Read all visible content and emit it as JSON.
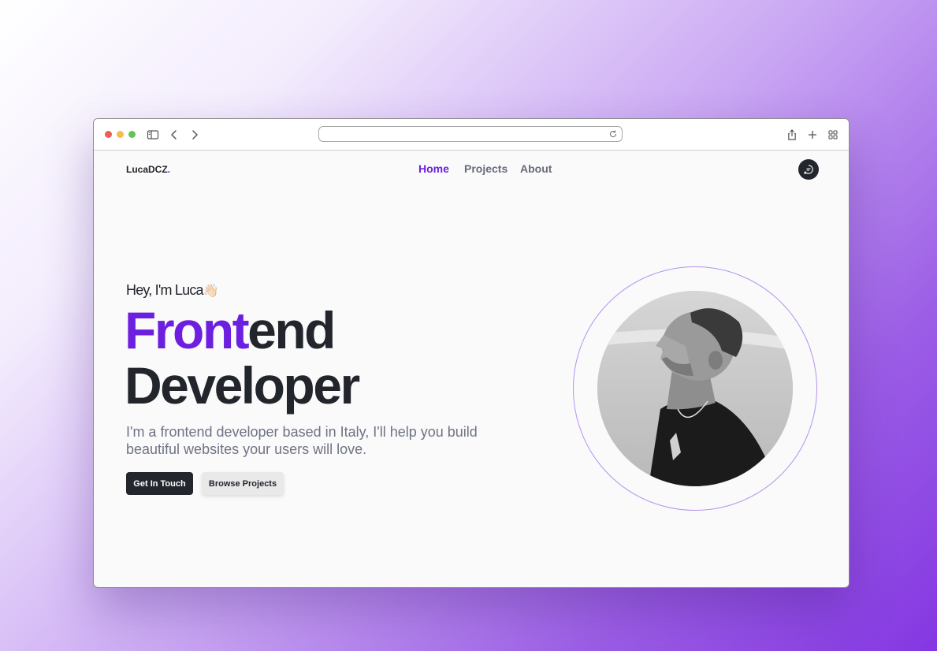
{
  "browser": {
    "url": "",
    "traffic_light_colors": [
      "#ee5f57",
      "#f5bd4f",
      "#61c554"
    ]
  },
  "site": {
    "logo": "LucaDCZ",
    "logo_dot": ".",
    "logo_dot_color": "#6d1fe0",
    "nav": [
      {
        "label": "Home",
        "active": true
      },
      {
        "label": "Projects",
        "active": false
      },
      {
        "label": "About",
        "active": false
      }
    ],
    "chat_icon": "chat-bubble-icon"
  },
  "hero": {
    "greeting": "Hey, I'm Luca",
    "greeting_emoji": "👋🏻",
    "headline_accent": "Front",
    "headline_rest": "end",
    "headline_line2": "Developer",
    "description": "I'm a frontend developer based in Italy, I'll help you build beautiful websites your users will love.",
    "primary_button": "Get In Touch",
    "secondary_button": "Browse Projects",
    "accent_color": "#6d1fe0"
  },
  "profile_photo": "grayscale-portrait-man"
}
